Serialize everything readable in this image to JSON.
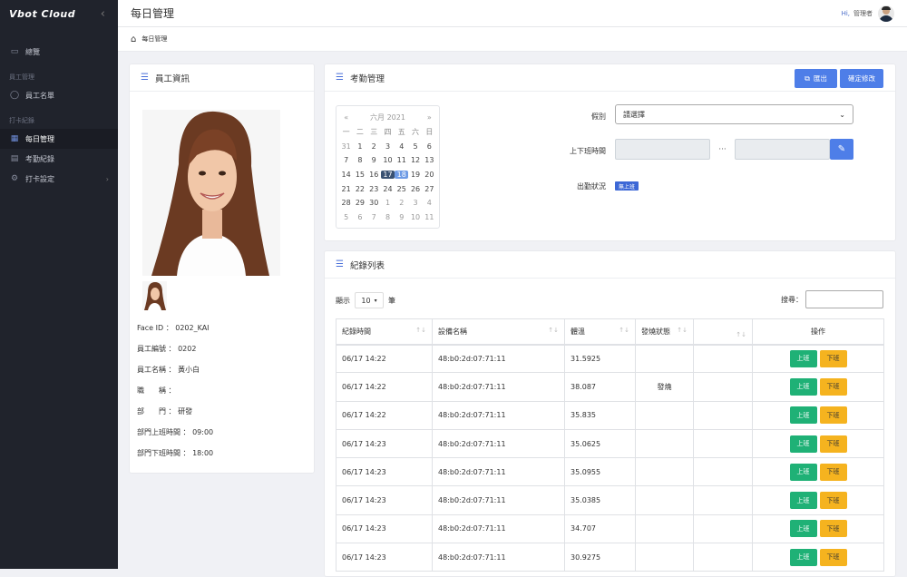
{
  "app": {
    "logo": "Vbot Cloud",
    "page_title": "每日管理"
  },
  "user": {
    "hi": "Hi,",
    "name": "管理者"
  },
  "breadcrumb": {
    "current": "每日管理"
  },
  "sidebar": {
    "overview": "總覽",
    "group_employee": "員工管理",
    "employee_list": "員工名單",
    "group_punch": "打卡紀錄",
    "daily": "每日管理",
    "attendance_records": "考勤紀錄",
    "punch_settings": "打卡設定"
  },
  "employee_card": {
    "title": "員工資訊",
    "face_id": "Face ID ： 0202_KAI",
    "emp_no": "員工編號 ： 0202",
    "emp_name": "員工名稱 ： 黃小白",
    "position": "職　　稱 ：",
    "department": "部　　門 ： 研發",
    "dept_in": "部門上班時間 ： 09:00",
    "dept_out": "部門下班時間 ： 18:00"
  },
  "attendance_card": {
    "title": "考勤管理",
    "export": "匯出",
    "confirm": "確定修改",
    "leave_label": "假別",
    "leave_value": "請選擇",
    "shift_label": "上下班時間",
    "dots": "···",
    "status_label": "出勤狀況",
    "status_badge": "無上班"
  },
  "calendar": {
    "prev": "«",
    "title": "六月 2021",
    "next": "»",
    "weekdays": [
      "一",
      "二",
      "三",
      "四",
      "五",
      "六",
      "日"
    ],
    "weeks": [
      [
        "31",
        "1",
        "2",
        "3",
        "4",
        "5",
        "6"
      ],
      [
        "7",
        "8",
        "9",
        "10",
        "11",
        "12",
        "13"
      ],
      [
        "14",
        "15",
        "16",
        "17",
        "18",
        "19",
        "20"
      ],
      [
        "21",
        "22",
        "23",
        "24",
        "25",
        "26",
        "27"
      ],
      [
        "28",
        "29",
        "30",
        "1",
        "2",
        "3",
        "4"
      ],
      [
        "5",
        "6",
        "7",
        "8",
        "9",
        "10",
        "11"
      ]
    ],
    "today": "17",
    "selected": "18"
  },
  "logs_card": {
    "title": "紀錄列表",
    "show": "顯示",
    "page_size": "10",
    "unit": "筆",
    "search_label": "搜尋：",
    "columns": [
      "紀錄時間",
      "設備名稱",
      "體溫",
      "發燒狀態",
      "",
      "操作"
    ],
    "btn_on": "上班",
    "btn_off": "下班",
    "rows": [
      {
        "time": "06/17 14:22",
        "device": "48:b0:2d:07:71:11",
        "temp": "31.5925",
        "fever": ""
      },
      {
        "time": "06/17 14:22",
        "device": "48:b0:2d:07:71:11",
        "temp": "38.087",
        "fever": "發燒"
      },
      {
        "time": "06/17 14:22",
        "device": "48:b0:2d:07:71:11",
        "temp": "35.835",
        "fever": ""
      },
      {
        "time": "06/17 14:23",
        "device": "48:b0:2d:07:71:11",
        "temp": "35.0625",
        "fever": ""
      },
      {
        "time": "06/17 14:23",
        "device": "48:b0:2d:07:71:11",
        "temp": "35.0955",
        "fever": ""
      },
      {
        "time": "06/17 14:23",
        "device": "48:b0:2d:07:71:11",
        "temp": "35.0385",
        "fever": ""
      },
      {
        "time": "06/17 14:23",
        "device": "48:b0:2d:07:71:11",
        "temp": "34.707",
        "fever": ""
      },
      {
        "time": "06/17 14:23",
        "device": "48:b0:2d:07:71:11",
        "temp": "30.9275",
        "fever": ""
      }
    ]
  },
  "colors": {
    "primary": "#4e7ee8",
    "success": "#1fb176",
    "warning": "#f5b31f",
    "sidebar": "#20232c"
  }
}
